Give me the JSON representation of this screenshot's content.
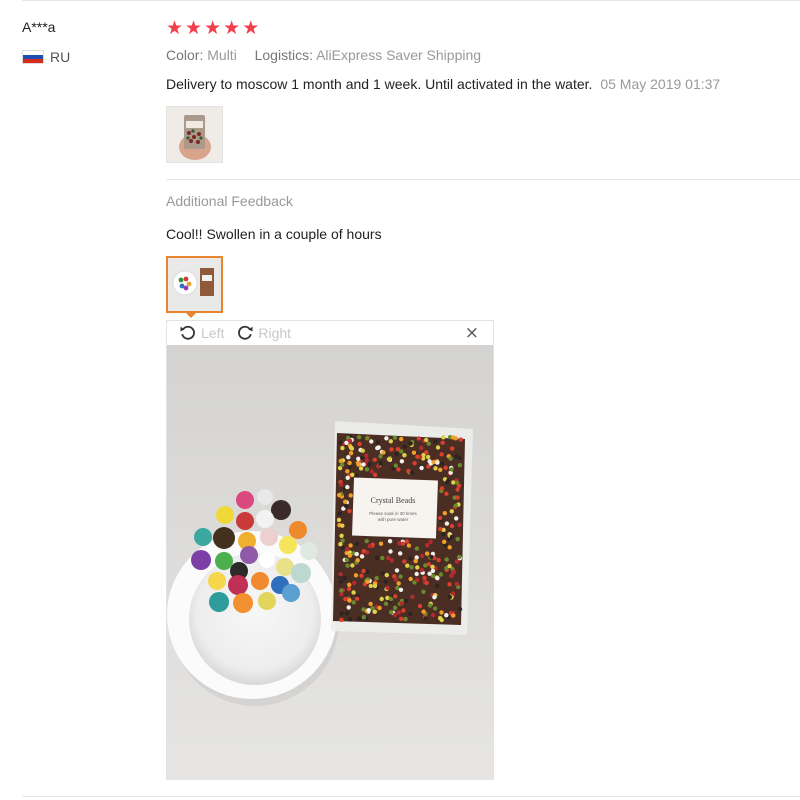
{
  "reviewer": {
    "name": "A***a",
    "country": "RU"
  },
  "rating": {
    "stars": 5
  },
  "meta": {
    "color_label": "Color:",
    "color_value": "Multi",
    "logistics_label": "Logistics:",
    "logistics_value": "AliExpress Saver Shipping"
  },
  "review": {
    "text": "Delivery to moscow 1 month and 1 week. Until activated in the water.",
    "date": "05 May 2019 01:37"
  },
  "additional": {
    "title": "Additional Feedback",
    "text": "Cool!! Swollen in a couple of hours"
  },
  "viewer": {
    "rotate_left": "Left",
    "rotate_right": "Right",
    "close": "×"
  },
  "bag_label": {
    "title": "Crystal Beads",
    "line1": "Please soak in 30 times",
    "line2": "with pure water"
  },
  "colors": {
    "star": "#f0404f",
    "active_border": "#e8852d"
  }
}
